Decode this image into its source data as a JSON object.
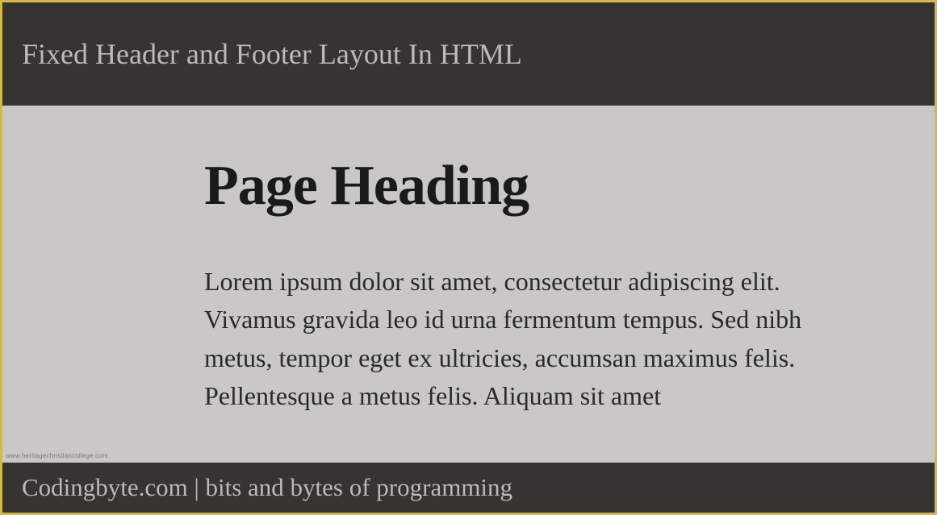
{
  "header": {
    "title": "Fixed Header and Footer Layout In HTML"
  },
  "main": {
    "heading": "Page Heading",
    "paragraph": "Lorem ipsum dolor sit amet, consectetur adipiscing elit. Vivamus gravida leo id urna fermentum tempus. Sed nibh metus, tempor eget ex ultricies, accumsan maximus felis. Pellentesque a metus felis. Aliquam sit amet"
  },
  "footer": {
    "text": "Codingbyte.com | bits and bytes of programming"
  },
  "watermark": "www.heritagechristiancollege.com"
}
